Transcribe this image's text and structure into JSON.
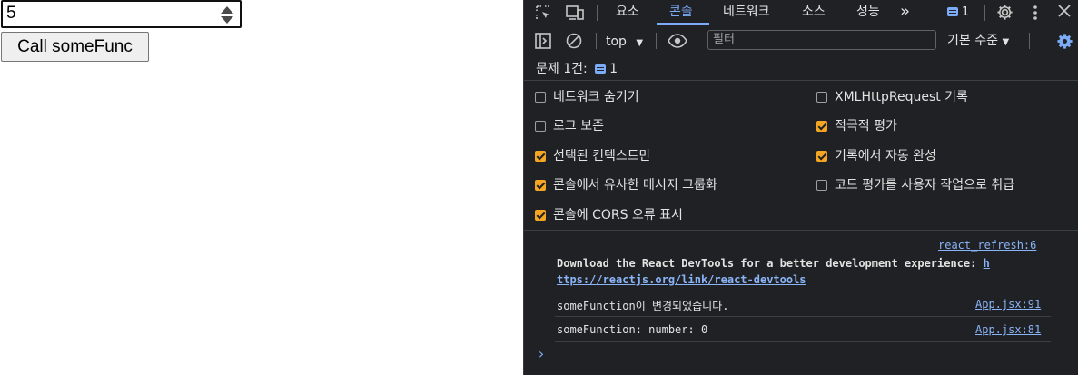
{
  "app": {
    "number_value": "5",
    "call_button_label": "Call someFunc"
  },
  "devtools": {
    "tabs": [
      {
        "label": "요소"
      },
      {
        "label": "콘솔"
      },
      {
        "label": "네트워크"
      },
      {
        "label": "소스"
      },
      {
        "label": "성능"
      }
    ],
    "more_tabs": "»",
    "issue_count": "1",
    "toolbar": {
      "context": "top",
      "filter_placeholder": "필터",
      "level": "기본 수준"
    },
    "issues_label": "문제 1건:",
    "issues_count": "1",
    "settings": {
      "left": [
        {
          "label": "네트워크 숨기기",
          "checked": false
        },
        {
          "label": "로그 보존",
          "checked": false
        },
        {
          "label": "선택된 컨텍스트만",
          "checked": true
        },
        {
          "label": "콘솔에서 유사한 메시지 그룹화",
          "checked": true
        },
        {
          "label": "콘솔에 CORS 오류 표시",
          "checked": true
        }
      ],
      "right": [
        {
          "label": "XMLHttpRequest 기록",
          "checked": false
        },
        {
          "label": "적극적 평가",
          "checked": true
        },
        {
          "label": "기록에서 자동 완성",
          "checked": true
        },
        {
          "label": "코드 평가를 사용자 작업으로 취급",
          "checked": false
        }
      ]
    },
    "messages": [
      {
        "source": "react_refresh:6",
        "text_1": "Download the React DevTools for a better development experience: ",
        "link_part_1": "h",
        "link_part_2": "ttps://reactjs.org/link/react-devtools"
      },
      {
        "text": "someFunction이 변경되었습니다.",
        "source": "App.jsx:91"
      },
      {
        "text": "someFunction: number: 0",
        "source": "App.jsx:81"
      }
    ],
    "prompt_symbol": "›"
  },
  "colors": {
    "devtools_bg": "#202124",
    "accent_blue": "#7cacf8",
    "checkbox_orange": "#f5a623"
  }
}
